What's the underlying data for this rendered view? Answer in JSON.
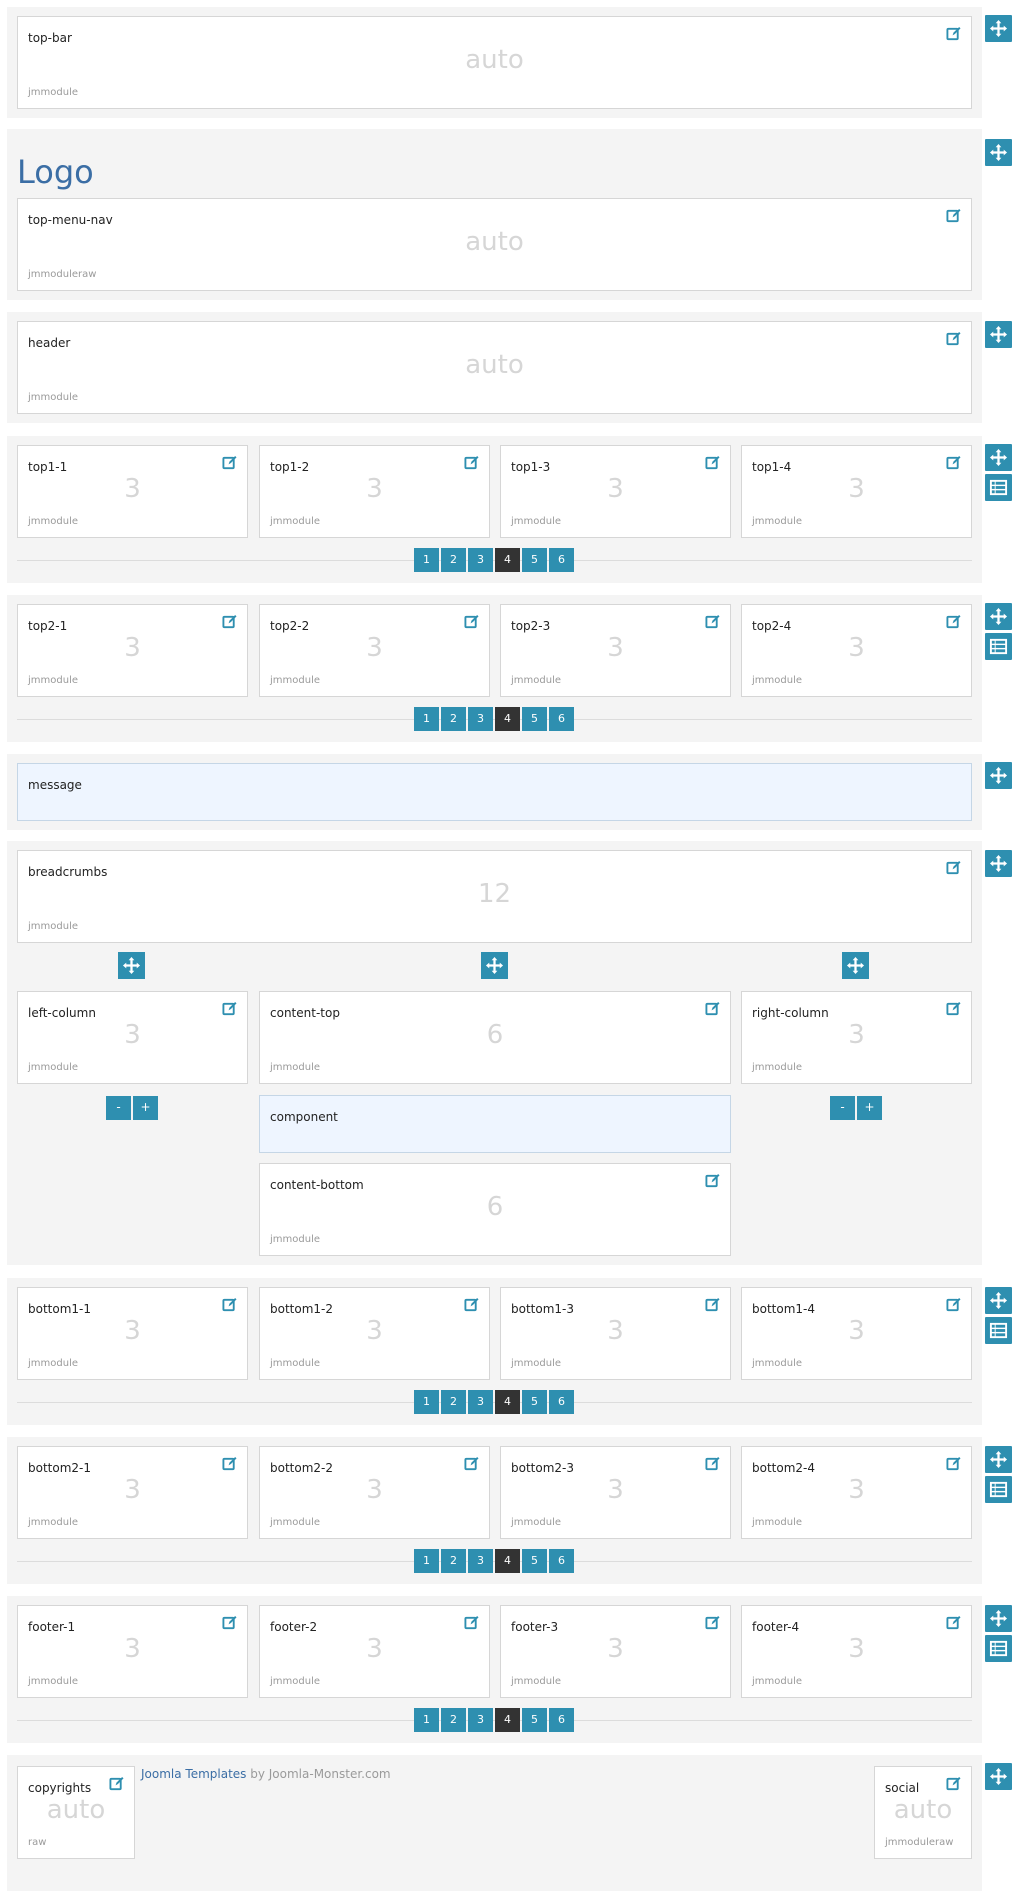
{
  "logo": {
    "text": "Logo"
  },
  "credit": {
    "link_text": "Joomla Templates",
    "rest_text": " by Joomla-Monster.com"
  },
  "rows": {
    "top_bar": {
      "module": {
        "name": "top-bar",
        "value": "auto",
        "type": "jmmodule"
      }
    },
    "logo_row": {
      "module": {
        "name": "top-menu-nav",
        "value": "auto",
        "type": "jmmoduleraw"
      }
    },
    "header": {
      "module": {
        "name": "header",
        "value": "auto",
        "type": "jmmodule"
      }
    },
    "top1": {
      "modules": [
        {
          "name": "top1-1",
          "value": "3",
          "type": "jmmodule"
        },
        {
          "name": "top1-2",
          "value": "3",
          "type": "jmmodule"
        },
        {
          "name": "top1-3",
          "value": "3",
          "type": "jmmodule"
        },
        {
          "name": "top1-4",
          "value": "3",
          "type": "jmmodule"
        }
      ]
    },
    "top2": {
      "modules": [
        {
          "name": "top2-1",
          "value": "3",
          "type": "jmmodule"
        },
        {
          "name": "top2-2",
          "value": "3",
          "type": "jmmodule"
        },
        {
          "name": "top2-3",
          "value": "3",
          "type": "jmmodule"
        },
        {
          "name": "top2-4",
          "value": "3",
          "type": "jmmodule"
        }
      ]
    },
    "message": {
      "module": {
        "name": "message"
      }
    },
    "main": {
      "breadcrumbs": {
        "name": "breadcrumbs",
        "value": "12",
        "type": "jmmodule"
      },
      "left_column": {
        "name": "left-column",
        "value": "3",
        "type": "jmmodule"
      },
      "content_top": {
        "name": "content-top",
        "value": "6",
        "type": "jmmodule"
      },
      "right_column": {
        "name": "right-column",
        "value": "3",
        "type": "jmmodule"
      },
      "component": {
        "name": "component"
      },
      "content_bottom": {
        "name": "content-bottom",
        "value": "6",
        "type": "jmmodule"
      },
      "minus_label": "-",
      "plus_label": "+"
    },
    "bottom1": {
      "modules": [
        {
          "name": "bottom1-1",
          "value": "3",
          "type": "jmmodule"
        },
        {
          "name": "bottom1-2",
          "value": "3",
          "type": "jmmodule"
        },
        {
          "name": "bottom1-3",
          "value": "3",
          "type": "jmmodule"
        },
        {
          "name": "bottom1-4",
          "value": "3",
          "type": "jmmodule"
        }
      ]
    },
    "bottom2": {
      "modules": [
        {
          "name": "bottom2-1",
          "value": "3",
          "type": "jmmodule"
        },
        {
          "name": "bottom2-2",
          "value": "3",
          "type": "jmmodule"
        },
        {
          "name": "bottom2-3",
          "value": "3",
          "type": "jmmodule"
        },
        {
          "name": "bottom2-4",
          "value": "3",
          "type": "jmmodule"
        }
      ]
    },
    "footer": {
      "modules": [
        {
          "name": "footer-1",
          "value": "3",
          "type": "jmmodule"
        },
        {
          "name": "footer-2",
          "value": "3",
          "type": "jmmodule"
        },
        {
          "name": "footer-3",
          "value": "3",
          "type": "jmmodule"
        },
        {
          "name": "footer-4",
          "value": "3",
          "type": "jmmodule"
        }
      ]
    },
    "copyrights": {
      "left": {
        "name": "copyrights",
        "value": "auto",
        "type": "raw"
      },
      "right": {
        "name": "social",
        "value": "auto",
        "type": "jmmoduleraw"
      }
    }
  },
  "column_selector": {
    "options": [
      "1",
      "2",
      "3",
      "4",
      "5",
      "6"
    ],
    "selected": "4"
  },
  "icons": {
    "move": "move-arrows-icon",
    "layout": "layout-list-icon",
    "edit": "edit-icon"
  },
  "colors": {
    "accent": "#2e8fb0",
    "active": "#333333",
    "logo": "#3b6ea5",
    "highlight": "#eef5ff"
  }
}
